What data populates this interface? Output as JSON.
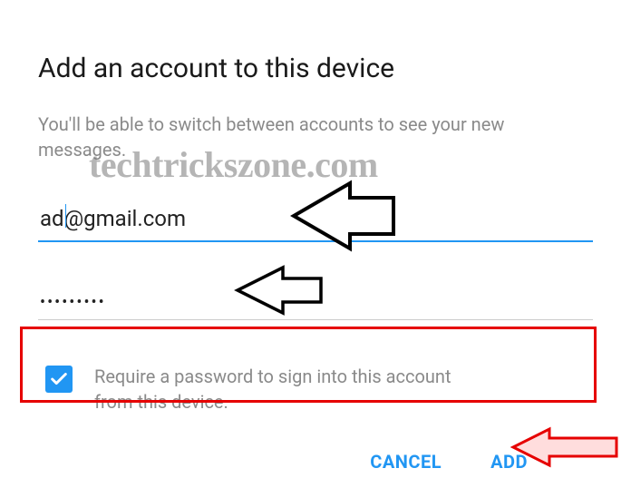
{
  "dialog": {
    "title": "Add an account to this device",
    "subtitle": "You'll be able to switch between accounts to see your new messages."
  },
  "fields": {
    "email_value": "ad@gmail.com",
    "password_value": "•••••••••"
  },
  "checkbox": {
    "checked": true,
    "label": "Require a password to sign into this account from this device."
  },
  "actions": {
    "cancel": "CANCEL",
    "add": "ADD"
  },
  "annotation": {
    "watermark": "techtrickszone.com"
  }
}
